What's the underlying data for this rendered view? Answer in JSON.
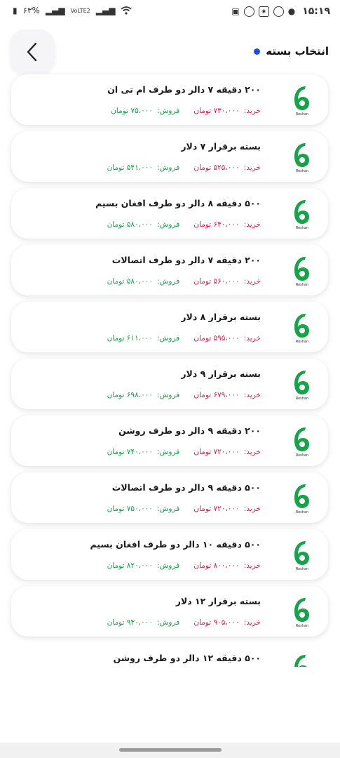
{
  "status_bar": {
    "time": "۱۵:۱۹",
    "battery": "۶۳%",
    "network": "VoLTE2"
  },
  "header": {
    "title": "انتخاب بسته"
  },
  "labels": {
    "buy": "خرید:",
    "sell": "فروش:"
  },
  "packages": [
    {
      "name": "۲۰۰ دقیقه  ۷ دالر دو طرف  ام تی ان",
      "buy": "۷۳۰،۰۰۰ تومان",
      "sell": "۷۵،۰۰۰ تومان"
    },
    {
      "name": "بسته برقرار ۷ دلار",
      "buy": "۵۲۵،۰۰۰ تومان",
      "sell": "۵۴۱،۰۰۰ تومان"
    },
    {
      "name": "۵۰۰ دقیقه  ۸ دالر دو طرف افغان بسیم",
      "buy": "۶۴۰،۰۰۰ تومان",
      "sell": "۵۸۰،۰۰۰ تومان"
    },
    {
      "name": "۲۰۰ دقیقه  ۷ دالر دو طرف  اتصالات",
      "buy": "۵۶۰،۰۰۰ تومان",
      "sell": "۵۸۰،۰۰۰ تومان"
    },
    {
      "name": "بسته برقرار ۸ دلار",
      "buy": "۵۹۵،۰۰۰ تومان",
      "sell": "۶۱۱،۰۰۰ تومان"
    },
    {
      "name": "بسته برقرار ۹ دلار",
      "buy": "۶۷۹،۰۰۰ تومان",
      "sell": "۶۹۸،۰۰۰ تومان"
    },
    {
      "name": "۲۰۰ دقیقه  ۹ دالر دو طرف  روشن",
      "buy": "۷۲۰،۰۰۰ تومان",
      "sell": "۷۴۰،۰۰۰ تومان"
    },
    {
      "name": "۵۰۰ دقیقه  ۹ دالر دو طرف  اتصالات",
      "buy": "۷۲۰،۰۰۰ تومان",
      "sell": "۷۵۰،۰۰۰ تومان"
    },
    {
      "name": "۵۰۰ دقیقه  ۱۰ دالر دو طرف افغان بسیم",
      "buy": "۸۰۰،۰۰۰ تومان",
      "sell": "۸۲۰،۰۰۰ تومان"
    },
    {
      "name": "بسته برقرار ۱۲ دلار",
      "buy": "۹۰۵،۰۰۰ تومان",
      "sell": "۹۳۰،۰۰۰ تومان"
    },
    {
      "name": "۵۰۰ دقیقه  ۱۲ دالر دو طرف  روشن"
    }
  ],
  "colors": {
    "accent_dot": "#1d4ed8",
    "buy": "#e11d48",
    "sell": "#16a34a",
    "logo": "#16a34a"
  },
  "icons": [
    "back-chevron-icon",
    "roshan-logo-icon",
    "wifi-icon",
    "signal-icon",
    "battery-icon"
  ]
}
